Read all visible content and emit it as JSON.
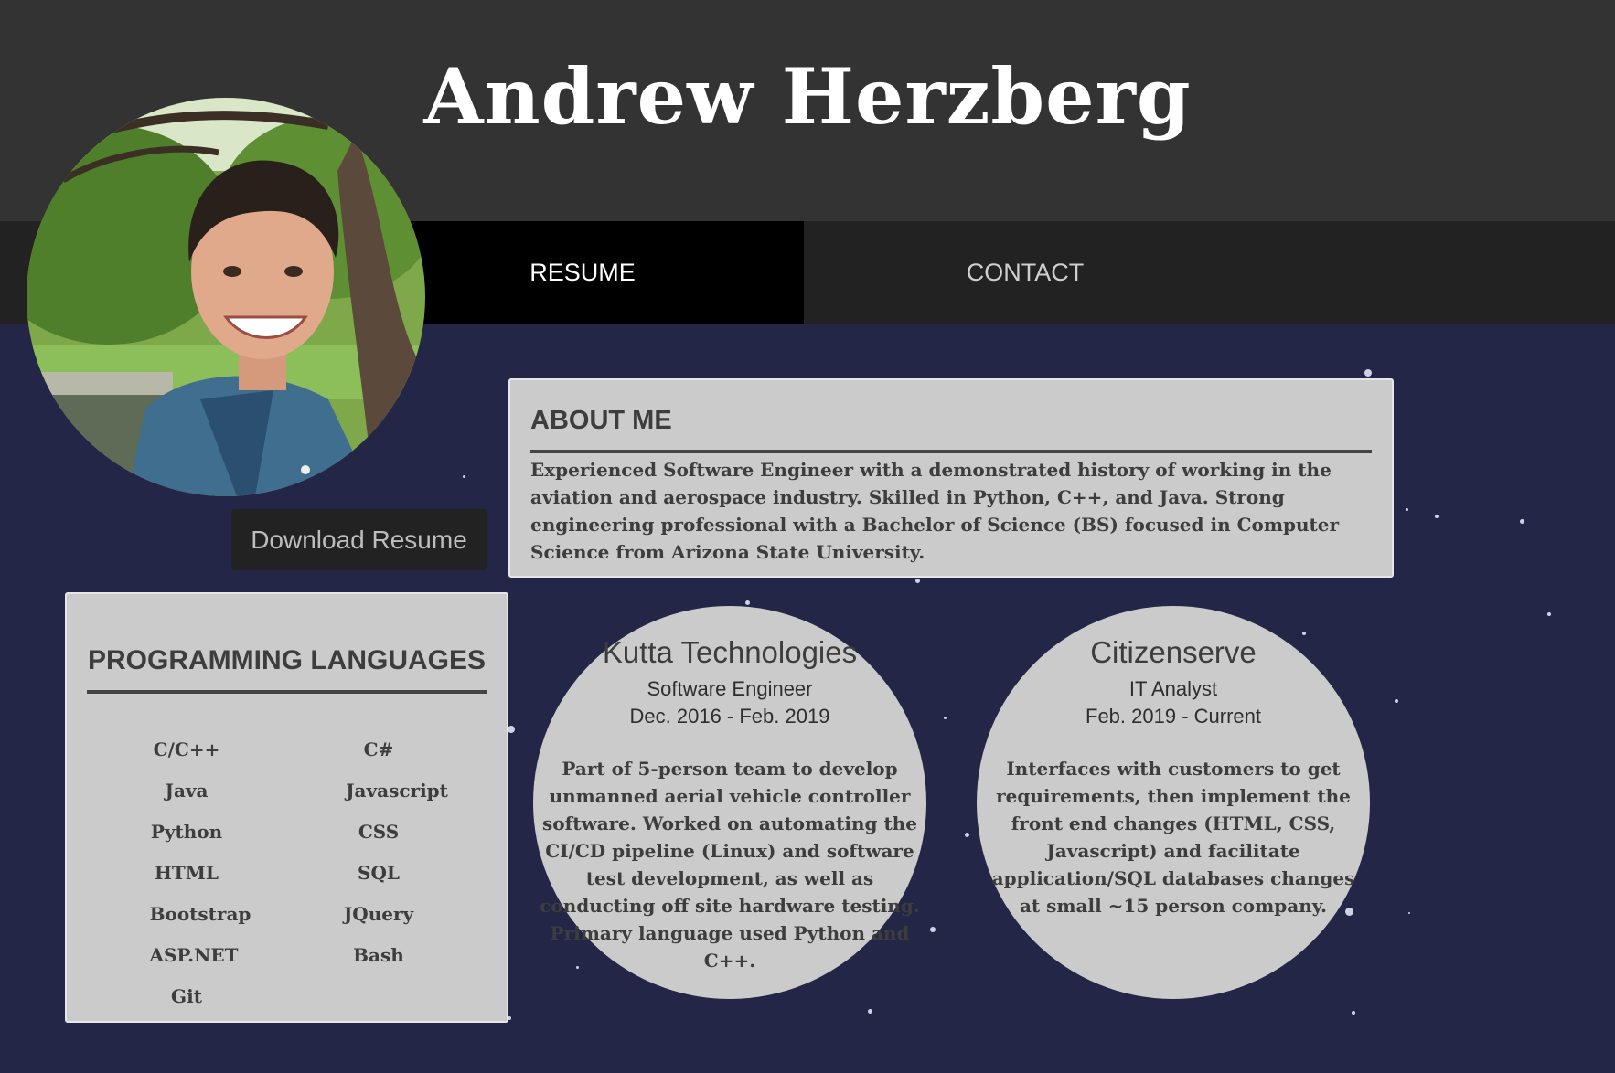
{
  "header": {
    "name": "Andrew Herzberg"
  },
  "nav": {
    "tabs": [
      {
        "label": "RESUME",
        "active": true
      },
      {
        "label": "CONTACT",
        "active": false
      }
    ]
  },
  "profile": {
    "download_label": "Download Resume"
  },
  "about": {
    "heading": "ABOUT ME",
    "text": "Experienced Software Engineer with a demonstrated history of working in the aviation and aerospace industry. Skilled in Python, C++, and Java. Strong engineering professional with a Bachelor of Science (BS) focused in Computer Science from Arizona State University."
  },
  "languages": {
    "heading": "PROGRAMMING LANGUAGES",
    "items": [
      "C/C++",
      "C#",
      "Java",
      "Javascript",
      "Python",
      "CSS",
      "HTML",
      "SQL",
      "Bootstrap",
      "JQuery",
      "ASP.NET",
      "Bash",
      "Git"
    ]
  },
  "jobs": [
    {
      "company": "Kutta Technologies",
      "role": "Software Engineer",
      "dates": "Dec. 2016 - Feb. 2019",
      "description": "Part of 5-person team to develop unmanned aerial vehicle controller software. Worked on automating the CI/CD pipeline (Linux) and software test development, as well as conducting off site hardware testing. Primary language used Python and C++."
    },
    {
      "company": "Citizenserve",
      "role": "IT Analyst",
      "dates": "Feb. 2019 - Current",
      "description": "Interfaces with customers to get requirements, then implement the front end changes (HTML, CSS, Javascript) and facilitate application/SQL databases changes at small ~15 person company."
    }
  ],
  "colors": {
    "background": "#232646",
    "header": "#333333",
    "nav": "#222222",
    "nav_active": "#000000",
    "card": "#cbcbcb",
    "text": "#3d3d3d"
  }
}
